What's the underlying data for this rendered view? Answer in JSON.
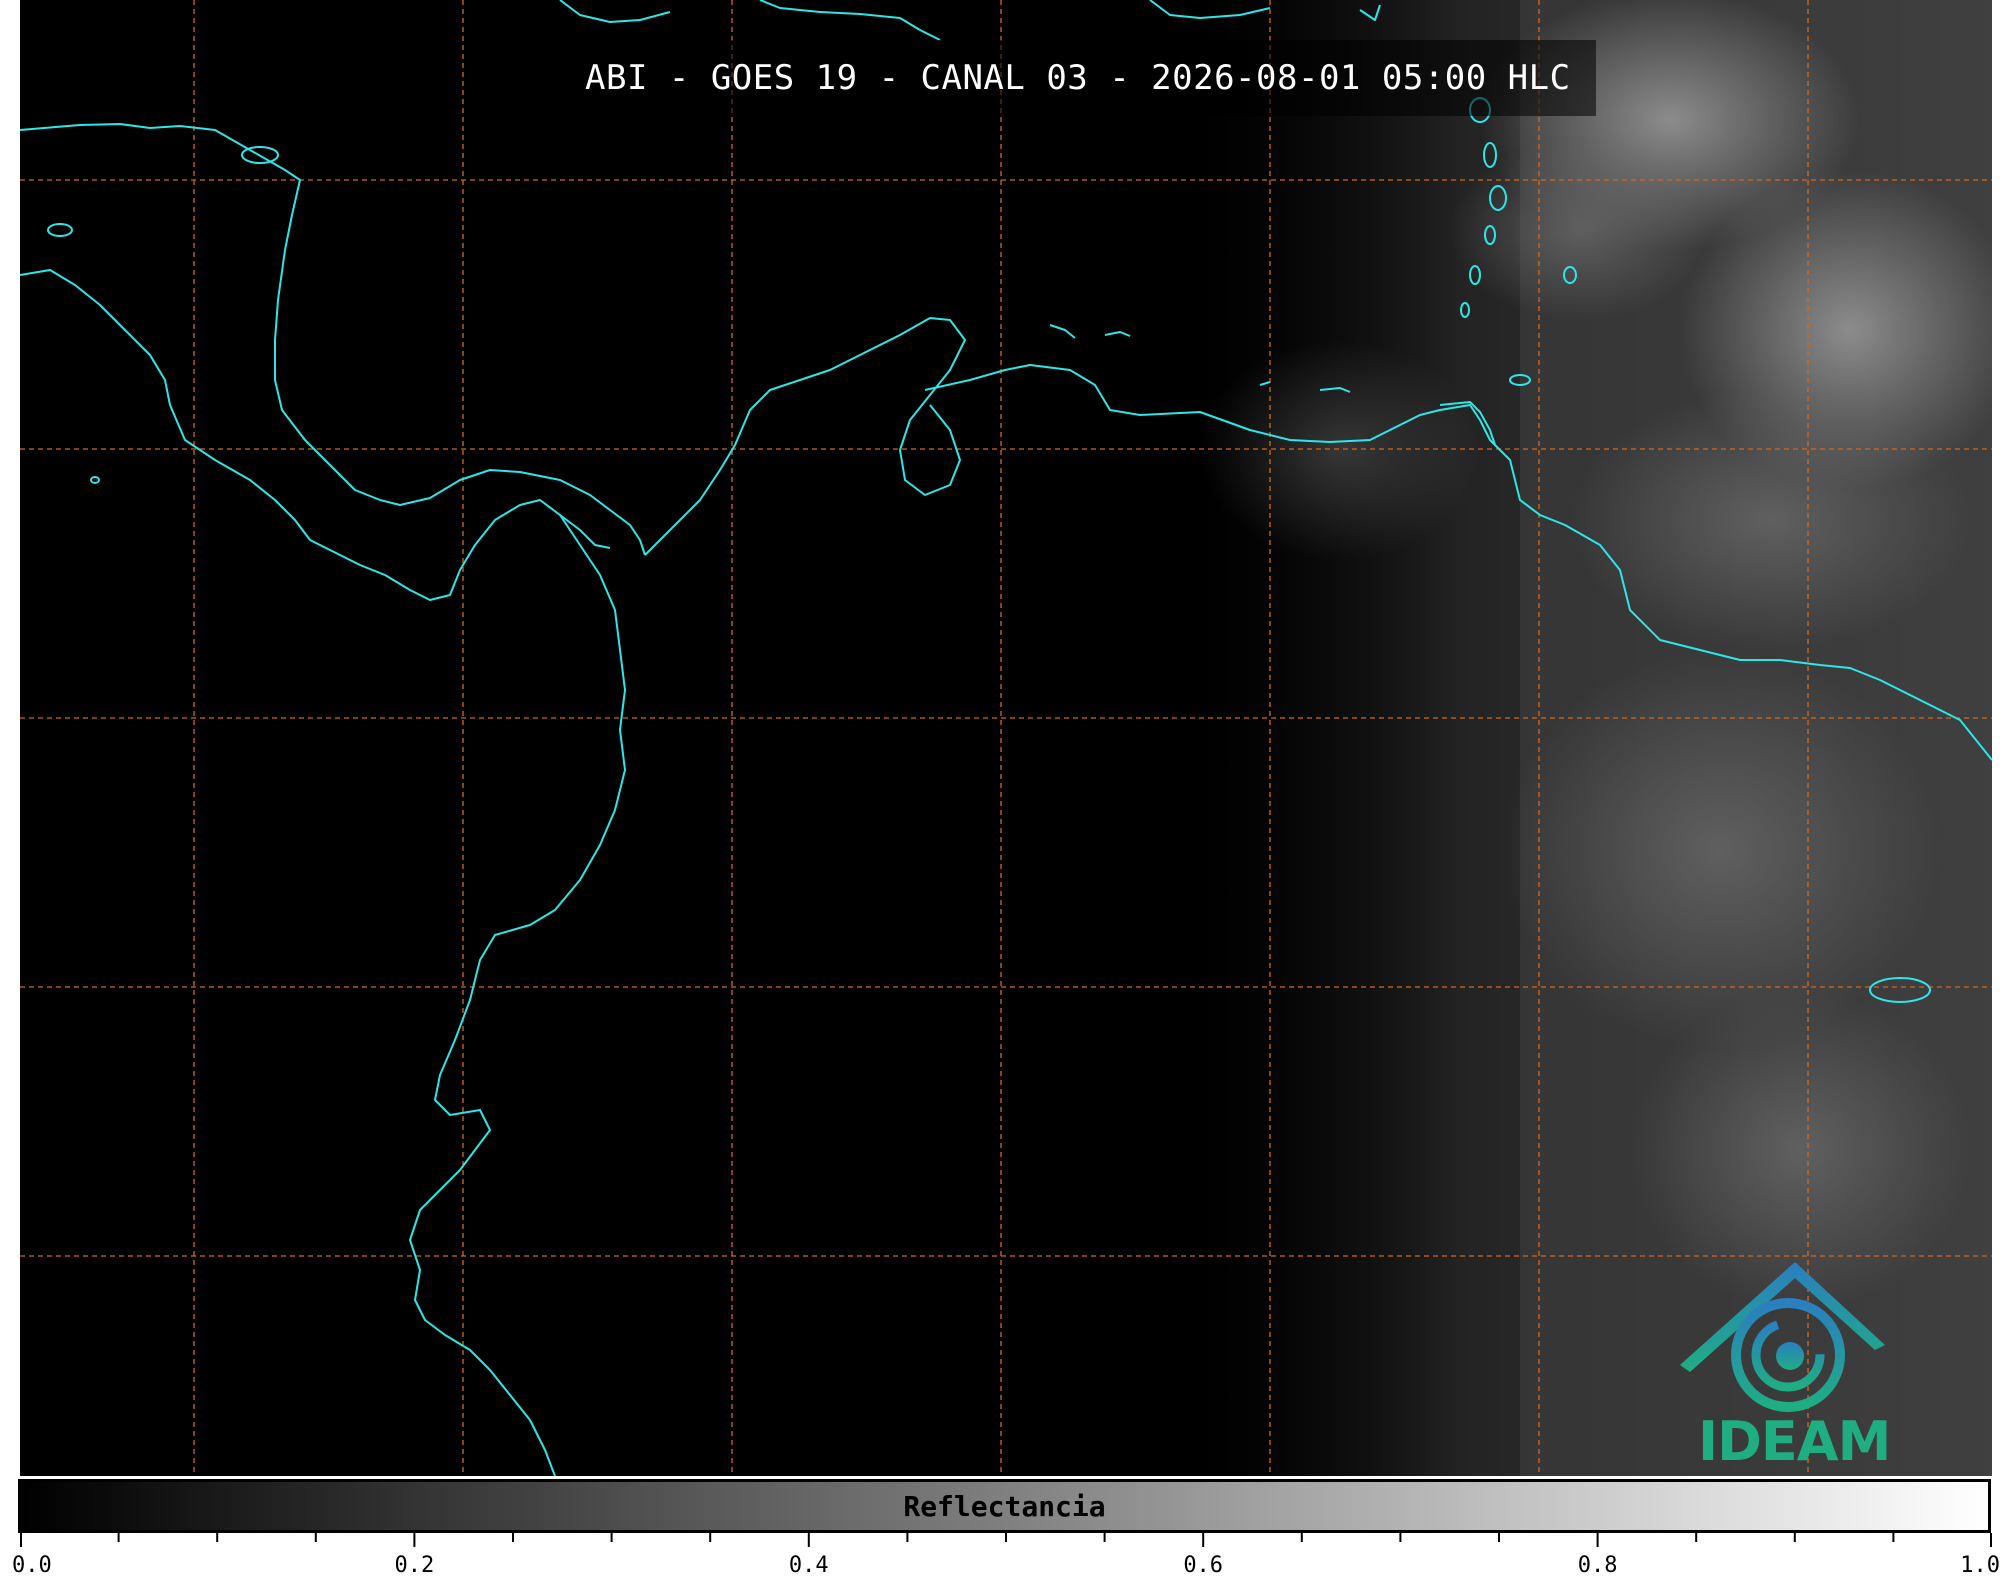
{
  "map": {
    "title": "ABI - GOES 19 - CANAL 03 - 2026-08-01 05:00 HLC",
    "coastline_color": "#2ee6e6",
    "grid_color": "#d2691e",
    "background_color": "#000000"
  },
  "logo": {
    "text": "IDEAM",
    "colors": [
      "#2a7fc0",
      "#1fae82"
    ]
  },
  "colorbar": {
    "label": "Reflectancia",
    "min": 0.0,
    "max": 1.0,
    "tick_labels": [
      "0.0",
      "0.2",
      "0.4",
      "0.6",
      "0.8",
      "1.0"
    ],
    "minor_ticks": 20
  }
}
